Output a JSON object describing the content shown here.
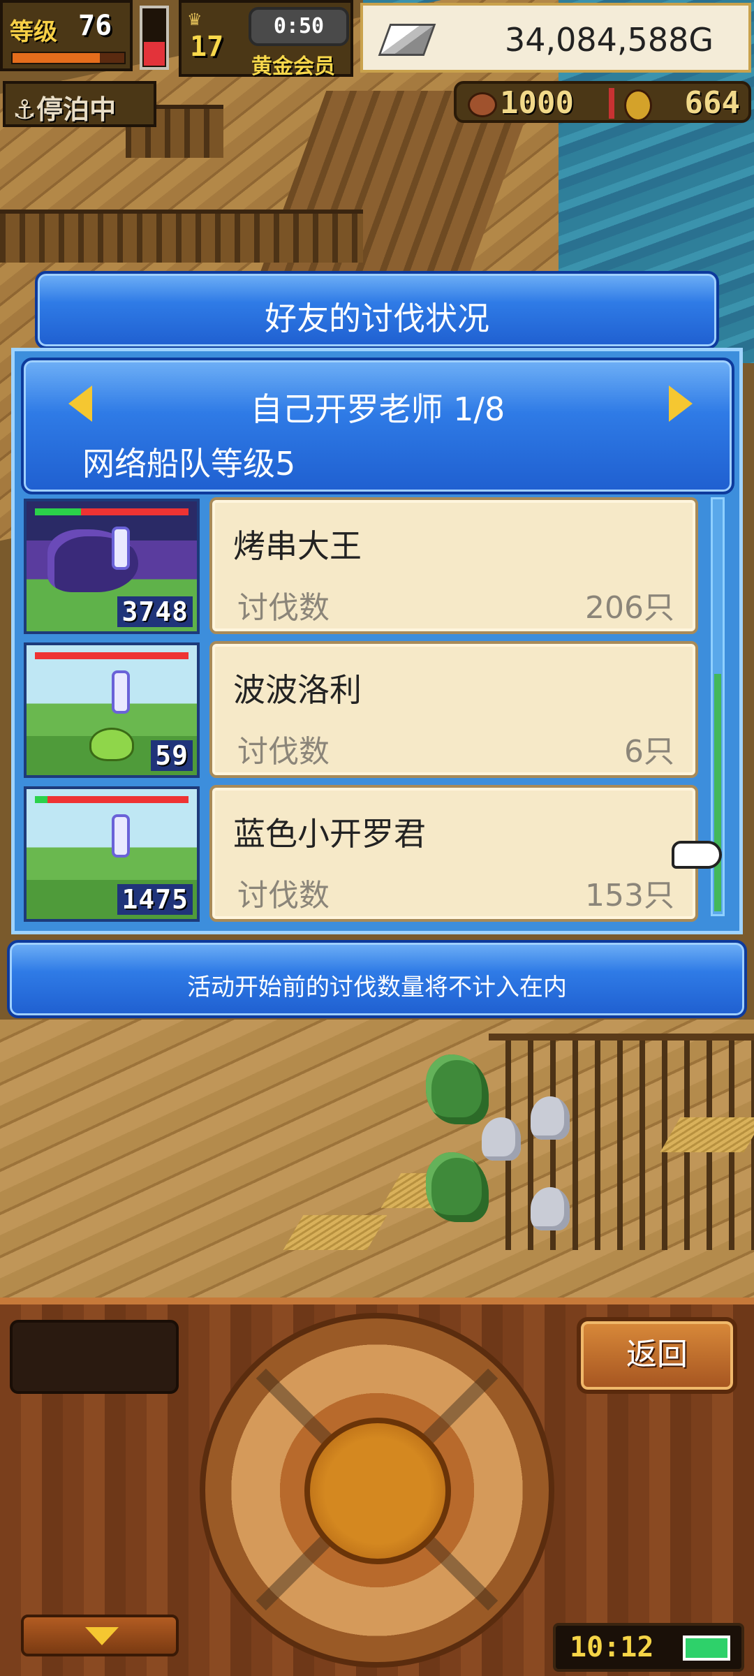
{
  "hud": {
    "level_label": "等级",
    "level_value": "76",
    "rank_value": "17",
    "timer": "0:50",
    "member_label": "黄金会员",
    "gold": "34,084,588G",
    "status": "停泊中",
    "resource_a": "1000",
    "resource_b": "664"
  },
  "dialog": {
    "title": "好友的讨伐状况",
    "friend_name": "自己开罗老师 1/8",
    "fleet_level": "网络船队等级5",
    "rows": [
      {
        "name": "烤串大王",
        "label": "讨伐数",
        "value": "206只",
        "thumb_count": "3748"
      },
      {
        "name": "波波洛利",
        "label": "讨伐数",
        "value": "6只",
        "thumb_count": "59"
      },
      {
        "name": "蓝色小开罗君",
        "label": "讨伐数",
        "value": "153只",
        "thumb_count": "1475"
      }
    ],
    "note": "活动开始前的讨伐数量将不计入在内"
  },
  "controls": {
    "back_label": "返回",
    "clock": "10:12"
  },
  "colors": {
    "dialog_blue": "#2f7be6",
    "card_bg": "#f6e9c8",
    "arrow_gold": "#f5c731"
  }
}
